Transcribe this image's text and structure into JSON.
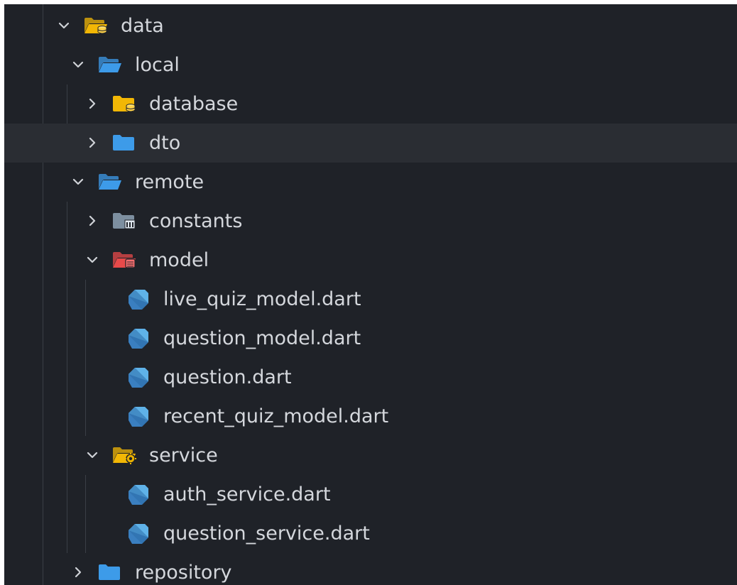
{
  "tree": [
    {
      "label": "data",
      "kind": "folder",
      "icon": "folder-database-open-icon",
      "expanded": true,
      "depth": 0
    },
    {
      "label": "local",
      "kind": "folder",
      "icon": "folder-open-icon",
      "expanded": true,
      "depth": 1
    },
    {
      "label": "database",
      "kind": "folder",
      "icon": "folder-database-icon",
      "expanded": false,
      "depth": 2
    },
    {
      "label": "dto",
      "kind": "folder",
      "icon": "folder-icon",
      "expanded": false,
      "depth": 2,
      "hovered": true
    },
    {
      "label": "remote",
      "kind": "folder",
      "icon": "folder-open-icon",
      "expanded": true,
      "depth": 1
    },
    {
      "label": "constants",
      "kind": "folder",
      "icon": "folder-constants-icon",
      "expanded": false,
      "depth": 2
    },
    {
      "label": "model",
      "kind": "folder",
      "icon": "folder-model-open-icon",
      "expanded": true,
      "depth": 2
    },
    {
      "label": "live_quiz_model.dart",
      "kind": "file",
      "icon": "dart-file-icon",
      "depth": 3
    },
    {
      "label": "question_model.dart",
      "kind": "file",
      "icon": "dart-file-icon",
      "depth": 3
    },
    {
      "label": "question.dart",
      "kind": "file",
      "icon": "dart-file-icon",
      "depth": 3
    },
    {
      "label": "recent_quiz_model.dart",
      "kind": "file",
      "icon": "dart-file-icon",
      "depth": 3
    },
    {
      "label": "service",
      "kind": "folder",
      "icon": "folder-service-open-icon",
      "expanded": true,
      "depth": 2
    },
    {
      "label": "auth_service.dart",
      "kind": "file",
      "icon": "dart-file-icon",
      "depth": 3
    },
    {
      "label": "question_service.dart",
      "kind": "file",
      "icon": "dart-file-icon",
      "depth": 3
    },
    {
      "label": "repository",
      "kind": "folder",
      "icon": "folder-icon",
      "expanded": false,
      "depth": 1
    }
  ],
  "colors": {
    "background": "#1f2228",
    "hover": "#2a2d33",
    "text": "#d4d7dc",
    "chevron": "#cfd2d7",
    "guide": "#3a3f46",
    "folder_yellow": "#f2b705",
    "folder_blue": "#3d9be9",
    "folder_red": "#e84a4a",
    "folder_gray": "#7d8fa0",
    "dart_blue": "#5fb2e8"
  }
}
